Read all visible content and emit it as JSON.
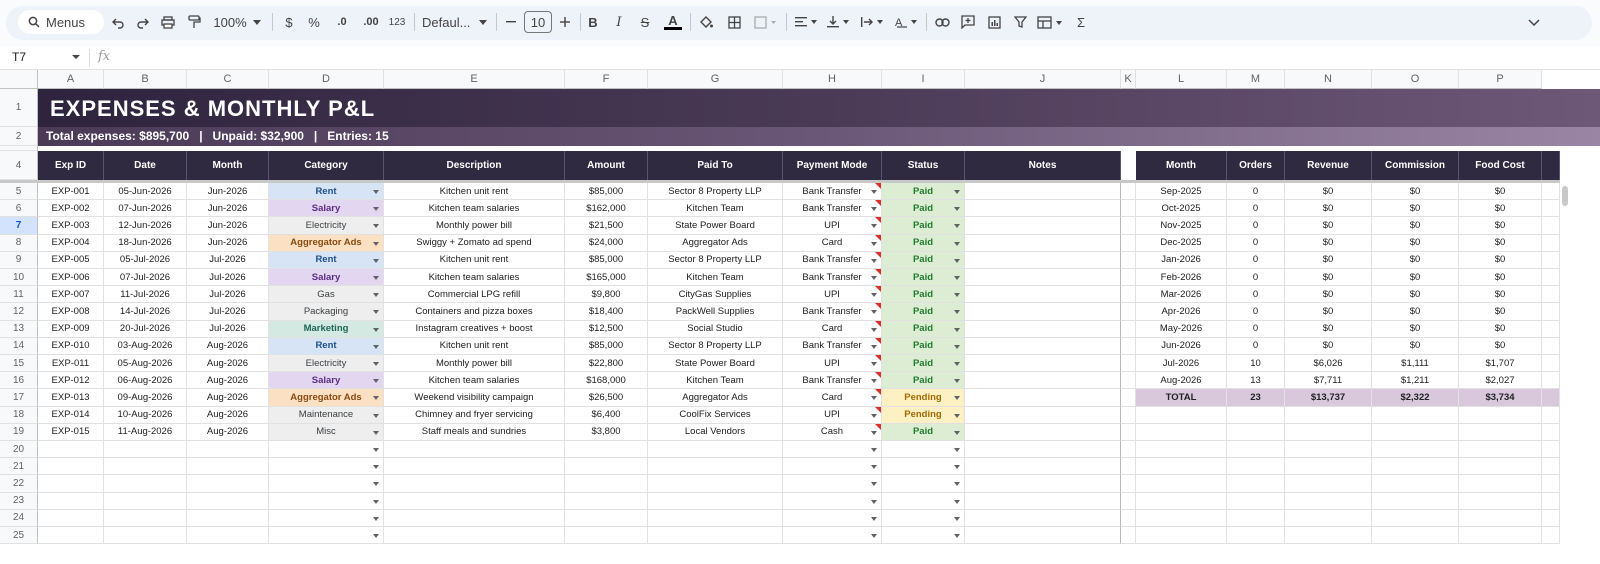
{
  "toolbar": {
    "search_label": "Menus",
    "zoom": "100%",
    "currency": "$",
    "percent": "%",
    "dec_decrease": ".0",
    "dec_increase": ".00",
    "number_format": "123",
    "font": "Defaul...",
    "font_size": "10"
  },
  "formula_bar": {
    "cell_ref": "T7",
    "fx": "fx"
  },
  "columns": [
    "A",
    "B",
    "C",
    "D",
    "E",
    "F",
    "G",
    "H",
    "I",
    "J",
    "K",
    "L",
    "M",
    "N",
    "O",
    "P"
  ],
  "rows": [
    "1",
    "2",
    "4",
    "5",
    "6",
    "7",
    "8",
    "9",
    "10",
    "11",
    "12",
    "13",
    "14",
    "15",
    "16",
    "17",
    "18",
    "19",
    "20",
    "21",
    "22",
    "23",
    "24",
    "25"
  ],
  "selected_row": "7",
  "title": "EXPENSES  &  MONTHLY P&L",
  "summary": "Total expenses: $895,700   |   Unpaid: $32,900   |   Entries: 15",
  "expenses": {
    "headers": [
      "Exp ID",
      "Date",
      "Month",
      "Category",
      "Description",
      "Amount",
      "Paid To",
      "Payment Mode",
      "Status",
      "Notes"
    ],
    "rows": [
      [
        "EXP-001",
        "05-Jun-2026",
        "Jun-2026",
        "Rent",
        "Kitchen unit rent",
        "$85,000",
        "Sector 8 Property LLP",
        "Bank Transfer",
        "Paid"
      ],
      [
        "EXP-002",
        "07-Jun-2026",
        "Jun-2026",
        "Salary",
        "Kitchen team salaries",
        "$162,000",
        "Kitchen Team",
        "Bank Transfer",
        "Paid"
      ],
      [
        "EXP-003",
        "12-Jun-2026",
        "Jun-2026",
        "Electricity",
        "Monthly power bill",
        "$21,500",
        "State Power Board",
        "UPI",
        "Paid"
      ],
      [
        "EXP-004",
        "18-Jun-2026",
        "Jun-2026",
        "Aggregator Ads",
        "Swiggy + Zomato ad spend",
        "$24,000",
        "Aggregator Ads",
        "Card",
        "Paid"
      ],
      [
        "EXP-005",
        "05-Jul-2026",
        "Jul-2026",
        "Rent",
        "Kitchen unit rent",
        "$85,000",
        "Sector 8 Property LLP",
        "Bank Transfer",
        "Paid"
      ],
      [
        "EXP-006",
        "07-Jul-2026",
        "Jul-2026",
        "Salary",
        "Kitchen team salaries",
        "$165,000",
        "Kitchen Team",
        "Bank Transfer",
        "Paid"
      ],
      [
        "EXP-007",
        "11-Jul-2026",
        "Jul-2026",
        "Gas",
        "Commercial LPG refill",
        "$9,800",
        "CityGas Supplies",
        "UPI",
        "Paid"
      ],
      [
        "EXP-008",
        "14-Jul-2026",
        "Jul-2026",
        "Packaging",
        "Containers and pizza boxes",
        "$18,400",
        "PackWell Supplies",
        "Bank Transfer",
        "Paid"
      ],
      [
        "EXP-009",
        "20-Jul-2026",
        "Jul-2026",
        "Marketing",
        "Instagram creatives + boost",
        "$12,500",
        "Social Studio",
        "Card",
        "Paid"
      ],
      [
        "EXP-010",
        "03-Aug-2026",
        "Aug-2026",
        "Rent",
        "Kitchen unit rent",
        "$85,000",
        "Sector 8 Property LLP",
        "Bank Transfer",
        "Paid"
      ],
      [
        "EXP-011",
        "05-Aug-2026",
        "Aug-2026",
        "Electricity",
        "Monthly power bill",
        "$22,800",
        "State Power Board",
        "UPI",
        "Paid"
      ],
      [
        "EXP-012",
        "06-Aug-2026",
        "Aug-2026",
        "Salary",
        "Kitchen team salaries",
        "$168,000",
        "Kitchen Team",
        "Bank Transfer",
        "Paid"
      ],
      [
        "EXP-013",
        "09-Aug-2026",
        "Aug-2026",
        "Aggregator Ads",
        "Weekend visibility campaign",
        "$26,500",
        "Aggregator Ads",
        "Card",
        "Pending"
      ],
      [
        "EXP-014",
        "10-Aug-2026",
        "Aug-2026",
        "Maintenance",
        "Chimney and fryer servicing",
        "$6,400",
        "CoolFix Services",
        "UPI",
        "Pending"
      ],
      [
        "EXP-015",
        "11-Aug-2026",
        "Aug-2026",
        "Misc",
        "Staff meals and sundries",
        "$3,800",
        "Local Vendors",
        "Cash",
        "Paid"
      ]
    ]
  },
  "pl": {
    "headers": [
      "Month",
      "Orders",
      "Revenue",
      "Commission",
      "Food Cost"
    ],
    "rows": [
      [
        "Sep-2025",
        "0",
        "$0",
        "$0",
        "$0"
      ],
      [
        "Oct-2025",
        "0",
        "$0",
        "$0",
        "$0"
      ],
      [
        "Nov-2025",
        "0",
        "$0",
        "$0",
        "$0"
      ],
      [
        "Dec-2025",
        "0",
        "$0",
        "$0",
        "$0"
      ],
      [
        "Jan-2026",
        "0",
        "$0",
        "$0",
        "$0"
      ],
      [
        "Feb-2026",
        "0",
        "$0",
        "$0",
        "$0"
      ],
      [
        "Mar-2026",
        "0",
        "$0",
        "$0",
        "$0"
      ],
      [
        "Apr-2026",
        "0",
        "$0",
        "$0",
        "$0"
      ],
      [
        "May-2026",
        "0",
        "$0",
        "$0",
        "$0"
      ],
      [
        "Jun-2026",
        "0",
        "$0",
        "$0",
        "$0"
      ],
      [
        "Jul-2026",
        "10",
        "$6,026",
        "$1,111",
        "$1,707"
      ],
      [
        "Aug-2026",
        "13",
        "$7,711",
        "$1,211",
        "$2,027"
      ]
    ],
    "total": [
      "TOTAL",
      "23",
      "$13,737",
      "$2,322",
      "$3,734"
    ]
  },
  "colors": {
    "header_dark": "#2f2a40",
    "cat_blue_bg": "#d6e4f6",
    "cat_blue_fg": "#1f4e8c",
    "cat_purple_bg": "#e3d6f0",
    "cat_purple_fg": "#5b2d82",
    "cat_orange_bg": "#fbe0c3",
    "cat_orange_fg": "#8a4a10",
    "cat_teal_bg": "#d3e9e2",
    "cat_teal_fg": "#1e6655",
    "cat_grey_bg": "#eeeeee",
    "cat_grey_fg": "#3c4043",
    "paid_bg": "#dcedd4",
    "paid_fg": "#1e7a2e",
    "pending_bg": "#fdf1c4",
    "pending_fg": "#a36a00",
    "total_bg": "#d9c8dc"
  }
}
